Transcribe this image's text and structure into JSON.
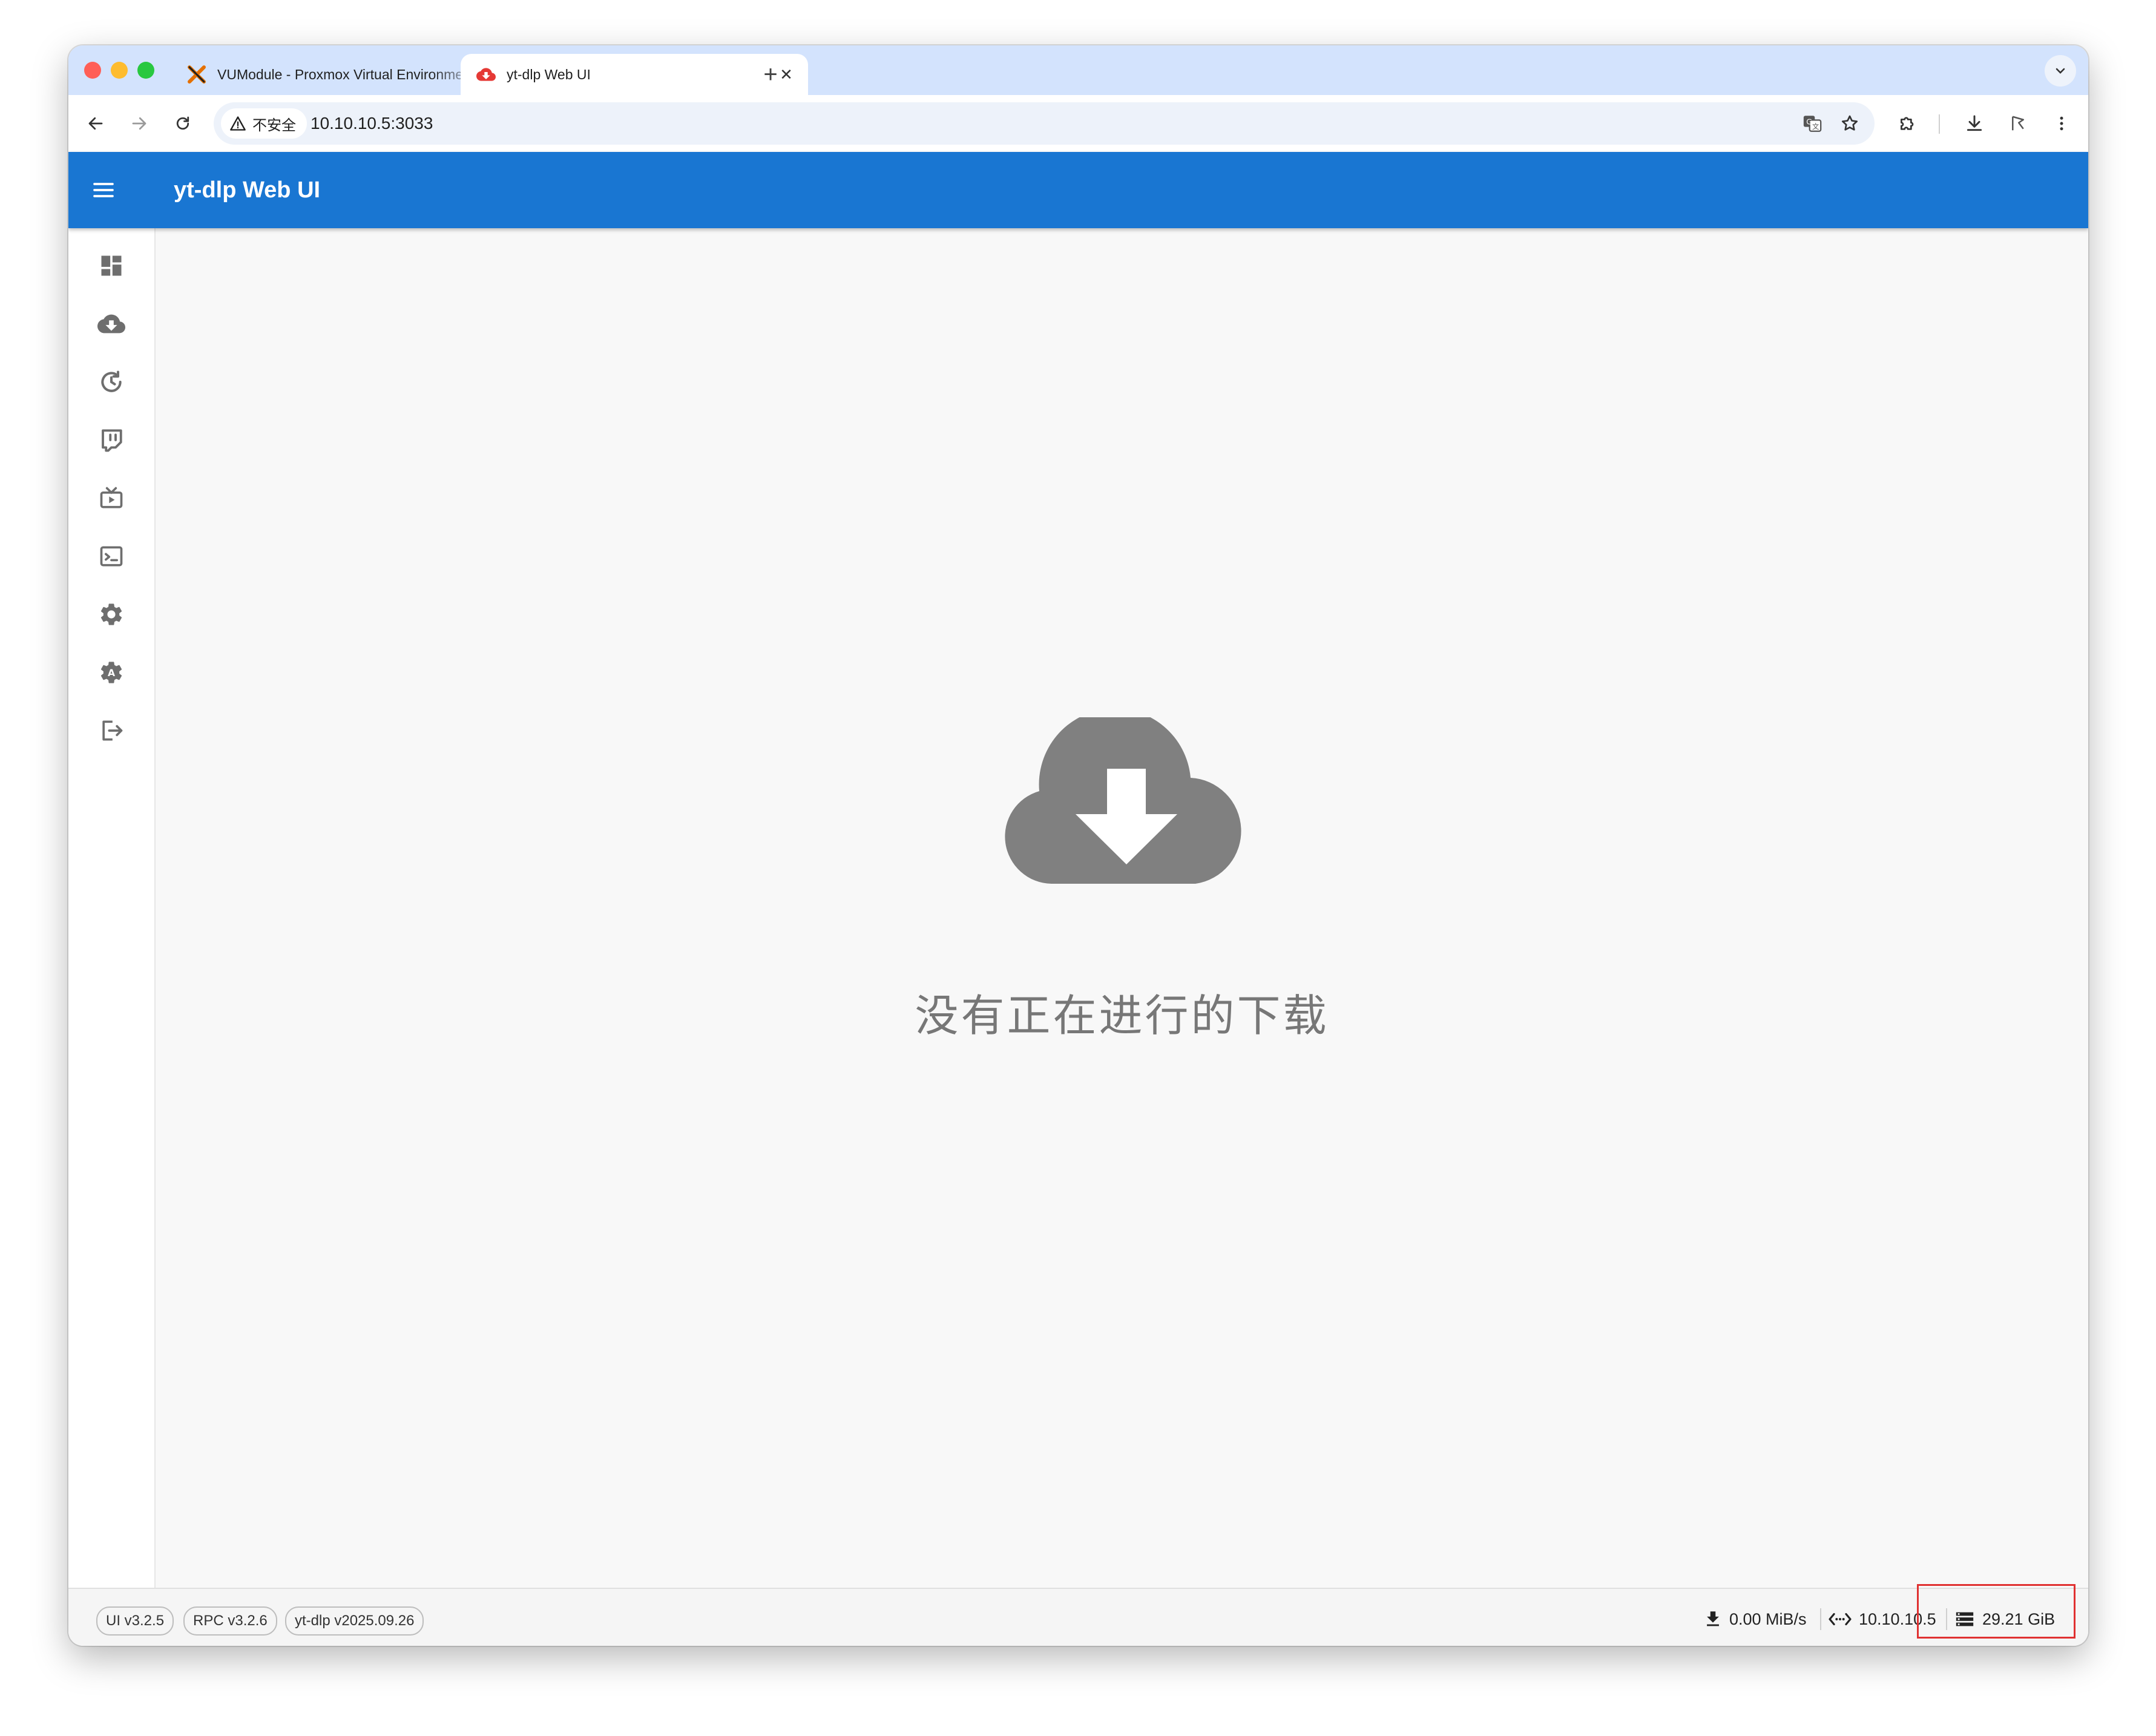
{
  "browser": {
    "tabs": [
      {
        "title": "VUModule - Proxmox Virtual Environment",
        "icon": "proxmox-icon",
        "active": false
      },
      {
        "title": "yt-dlp Web UI",
        "icon": "cloud-download-icon",
        "active": true
      }
    ],
    "security_label": "不安全",
    "url": "10.10.10.5:3033"
  },
  "app": {
    "title": "yt-dlp Web UI",
    "brand_color": "#1976d2",
    "sidebar_icons": [
      "dashboard-icon",
      "cloud-download-icon",
      "history-icon",
      "twitch-icon",
      "live-tv-icon",
      "terminal-icon",
      "settings-icon",
      "admin-icon",
      "logout-icon"
    ],
    "empty_state": {
      "icon": "cloud-download-icon",
      "message": "没有正在进行的下载"
    }
  },
  "footer": {
    "versions": [
      "UI v3.2.5",
      "RPC v3.2.6",
      "yt-dlp v2025.09.26"
    ],
    "download_speed": "0.00 MiB/s",
    "server_address": "10.10.10.5",
    "free_space": "29.21 GiB"
  }
}
